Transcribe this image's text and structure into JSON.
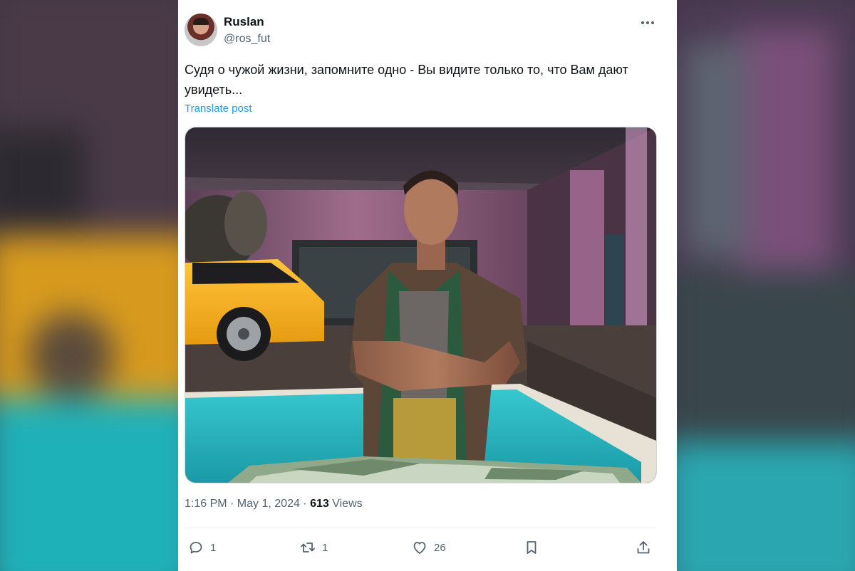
{
  "post": {
    "display_name": "Ruslan",
    "handle": "@ros_fut",
    "text": "Судя о чужой жизни, запомните одно - Вы видите только то, что Вам дают увидеть...",
    "translate_label": "Translate post",
    "timestamp": "1:16 PM · May 1, 2024 · ",
    "views_count": "613",
    "views_label": " Views"
  },
  "actions": {
    "replies": "1",
    "reposts": "1",
    "likes": "26"
  },
  "icons": {
    "more": "more-horizontal-icon",
    "reply": "reply-icon",
    "repost": "repost-icon",
    "like": "heart-icon",
    "bookmark": "bookmark-icon",
    "share": "share-icon"
  },
  "colors": {
    "link": "#1d9bf0",
    "secondary_text": "#536471",
    "primary_text": "#0f1419"
  }
}
